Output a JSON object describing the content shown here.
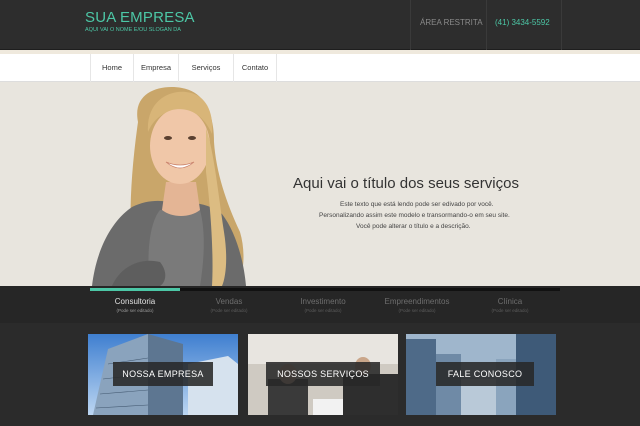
{
  "header": {
    "logo_title": "SUA EMPRESA",
    "logo_slogan": "AQUI VAI O NOME E/OU SLOGAN DA",
    "restricted_link": "ÁREA RESTRITA",
    "phone": "(41) 3434-5592"
  },
  "nav": {
    "items": [
      {
        "label": "Home"
      },
      {
        "label": "Empresa"
      },
      {
        "label": "Serviços"
      },
      {
        "label": "Contato"
      }
    ]
  },
  "hero": {
    "title": "Aqui vai o título dos seus serviços",
    "lines": [
      "Este texto que está lendo pode ser edivado por você.",
      "Personalizando assim este modelo e transormando-o em seu site.",
      "Você pode alterar o título e a descrição."
    ]
  },
  "tabs": [
    {
      "label": "Consultoria",
      "sub": "(Pode ser editado)",
      "active": true
    },
    {
      "label": "Vendas",
      "sub": "(Pode ser editado)",
      "active": false
    },
    {
      "label": "Investimento",
      "sub": "(Pode ser editado)",
      "active": false
    },
    {
      "label": "Empreendimentos",
      "sub": "(Pode ser editado)",
      "active": false
    },
    {
      "label": "Clínica",
      "sub": "(Pode ser editado)",
      "active": false
    }
  ],
  "features": [
    {
      "label": "NOSSA EMPRESA"
    },
    {
      "label": "NOSSOS SERVIÇOS"
    },
    {
      "label": "FALE CONOSCO"
    }
  ],
  "colors": {
    "accent": "#4cc7a6",
    "header_bg": "#2d2d2d",
    "hero_bg": "#e8e5de"
  }
}
